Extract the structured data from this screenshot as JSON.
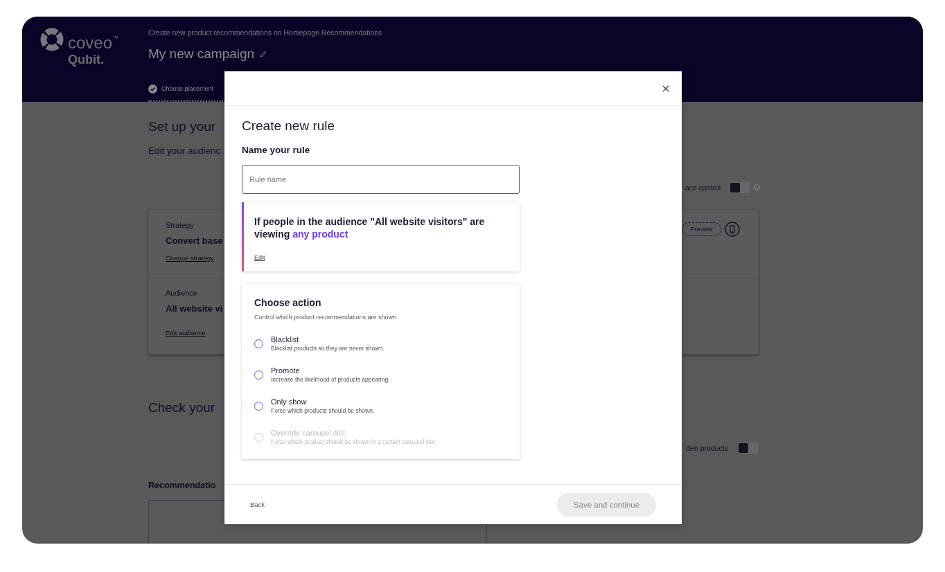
{
  "header": {
    "logo": {
      "wordmark": "coveo$^{™}$",
      "product": "Qubit."
    },
    "subtitle": "Create new product recommendations on Homepage Recommendations",
    "title": "My new campaign",
    "steps": [
      {
        "label": "Choose placement",
        "completed": true,
        "selected": true
      }
    ]
  },
  "page": {
    "setup_heading": "Set up your",
    "setup_intro": "Edit your audienc",
    "control_toggle": {
      "label": "ace control",
      "on": false,
      "help": "?"
    },
    "summary_card": {
      "rows": [
        {
          "label": "Strategy",
          "value": "Convert base",
          "link": "Change strategy",
          "preview_button": "Preview"
        },
        {
          "label": "Audience",
          "value": "All website vi",
          "link": "Edit audience"
        }
      ]
    },
    "check_heading": "Check your",
    "hidden_toggle": {
      "label": "den products",
      "on": false
    },
    "recommendations_label": "Recommendatio"
  },
  "modal": {
    "title": "Create new rule",
    "name_label": "Name your rule",
    "name_field": {
      "placeholder": "Rule name"
    },
    "condition": {
      "text": "If people in the audience \"All website visitors\" are viewing",
      "link": "any product",
      "edit_link": "Edit"
    },
    "actions": {
      "title": "Choose action",
      "subtitle": "Control which product recommendations are shown",
      "options": [
        {
          "label": "Blacklist",
          "description": "Blacklist products so they are never shown.",
          "selected": false,
          "disabled": false
        },
        {
          "label": "Promote",
          "description": "Increase the likelihood of products appearing.",
          "selected": false,
          "disabled": false
        },
        {
          "label": "Only show",
          "description": "Force which products should be shown.",
          "selected": false,
          "disabled": false
        },
        {
          "label": "Override carousel slot",
          "description": "Force which product should be shown in a certain carousel slot.",
          "selected": false,
          "disabled": true
        }
      ]
    },
    "back_button": "Back",
    "save_button": {
      "label": "Save and continue",
      "disabled": true
    }
  }
}
